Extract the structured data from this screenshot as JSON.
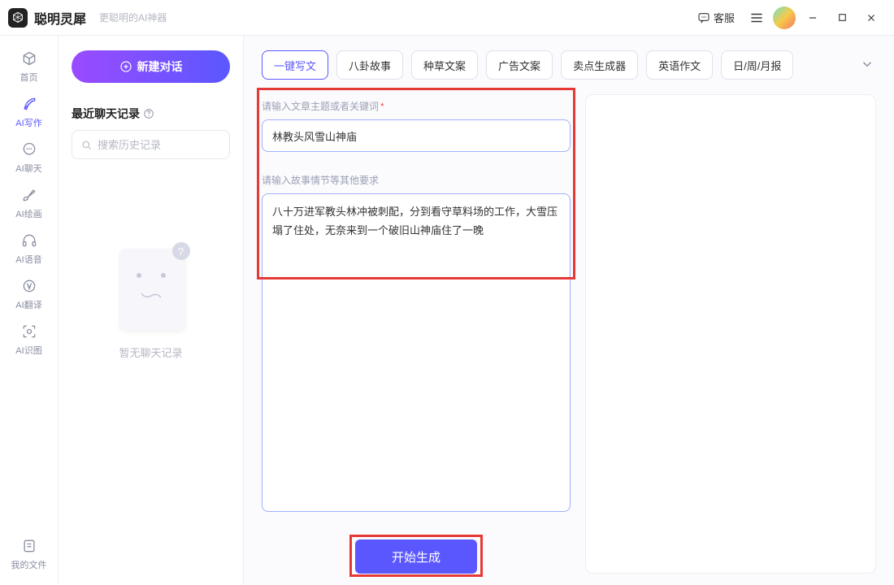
{
  "titlebar": {
    "app_name": "聪明灵犀",
    "tagline": "更聪明的AI神器",
    "support_label": "客服"
  },
  "nav": {
    "items": [
      {
        "label": "首页",
        "icon": "home"
      },
      {
        "label": "AI写作",
        "icon": "feather"
      },
      {
        "label": "AI聊天",
        "icon": "chat"
      },
      {
        "label": "AI绘画",
        "icon": "brush"
      },
      {
        "label": "AI语音",
        "icon": "audio"
      },
      {
        "label": "AI翻译",
        "icon": "translate"
      },
      {
        "label": "AI识图",
        "icon": "scan"
      }
    ],
    "footer": {
      "label": "我的文件",
      "icon": "folder"
    },
    "active_index": 1
  },
  "history": {
    "new_chat_label": "新建对话",
    "section_title": "最近聊天记录",
    "search_placeholder": "搜索历史记录",
    "empty_text": "暂无聊天记录",
    "empty_badge": "?"
  },
  "tags": {
    "items": [
      "一键写文",
      "八卦故事",
      "种草文案",
      "广告文案",
      "卖点生成器",
      "英语作文",
      "日/周/月报"
    ],
    "active_index": 0
  },
  "form": {
    "topic_label": "请输入文章主题或者关键词",
    "topic_value": "林教头风雪山神庙",
    "detail_label": "请输入故事情节等其他要求",
    "detail_value": "八十万进军教头林冲被刺配，分到看守草料场的工作，大雪压塌了住处，无奈来到一个破旧山神庙住了一晚",
    "generate_label": "开始生成"
  },
  "colors": {
    "accent": "#5b57ff",
    "accent_light": "#9a4bff",
    "highlight": "#e53935"
  }
}
